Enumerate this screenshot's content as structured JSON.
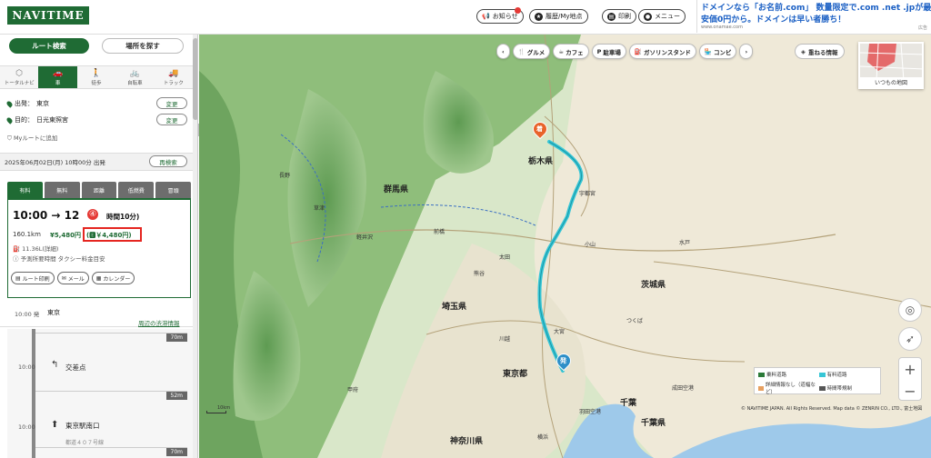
{
  "header": {
    "logo": "NAVITIME",
    "buttons": {
      "notice": "お知らせ",
      "history": "履歴/My地点",
      "print": "印刷",
      "menu": "メニュー"
    },
    "ad": {
      "line1": "ドメインなら「お名前.com」 数量限定で.com .net .jpが最",
      "line2": "安価0円から。ドメインは早い者勝ち！",
      "url": "www.onamae.com",
      "tag": "広告"
    }
  },
  "sidebar": {
    "modes": {
      "route": "ルート検索",
      "place": "場所を探す"
    },
    "transport": [
      {
        "label": "トータルナビ",
        "icon": "⬡"
      },
      {
        "label": "車",
        "icon": "🚗"
      },
      {
        "label": "徒歩",
        "icon": "🚶"
      },
      {
        "label": "自転車",
        "icon": "🚲"
      },
      {
        "label": "トラック",
        "icon": "🚚"
      }
    ],
    "origin_label": "出発：",
    "origin": "東京",
    "dest_label": "目的：",
    "dest": "日光東照宮",
    "change": "変更",
    "myroute": "Myルートに追加",
    "date": "2025年06月02日(月) 10時00分 出発",
    "research": "再検索",
    "fare_tabs": [
      "有料",
      "無料",
      "距離",
      "低燃費",
      "冒頭"
    ],
    "route": {
      "time": "10:00 → 12",
      "duration": "時間10分)",
      "badge": "④",
      "distance": "160.1km",
      "fare": "¥5,480円",
      "etc_fare": "(🅴￥4,480円)",
      "fuel": "11.36L(詳細)",
      "note": "予測所要時間 タクシー料金目安",
      "buttons": [
        "ルート印刷",
        "メール",
        "カレンダー"
      ]
    },
    "start": {
      "time": "10:00 発",
      "name": "東京",
      "nearby": "周辺の渋滞情報"
    },
    "steps": [
      {
        "dist": "70m"
      },
      {
        "time": "10:00",
        "icon": "↰",
        "name": "交差点"
      },
      {
        "dist": "52m"
      },
      {
        "time": "10:00",
        "icon": "⬆",
        "name": "東京駅南口",
        "sub": "都道４０７号線"
      },
      {
        "dist": "70m"
      }
    ]
  },
  "map": {
    "categories": [
      "グルメ",
      "カフェ",
      "駐車場",
      "ガソリンスタンド",
      "コンビ"
    ],
    "layers": "重ねる情報",
    "minimap_label": "いつもの地図",
    "legend": [
      "乗料道路",
      "有料道路",
      "詳細情報なし（道幅など）",
      "時間帯規制"
    ],
    "copyright": "© NAVITIME JAPAN. All Rights Reserved. Map data © ZENRIN CO., LTD., 富士地図",
    "scale": "10km",
    "labels": {
      "tochigi": "栃木県",
      "gunma": "群馬県",
      "saitama": "埼玉県",
      "ibaraki": "茨城県",
      "tokyo": "東京都",
      "kanagawa": "神奈川県",
      "chiba": "千葉県",
      "chiba2": "千葉",
      "nagano": "長野",
      "utsunomiya": "宇都宮",
      "oyama": "小山",
      "mito": "水戸",
      "maebashi": "前橋",
      "kumagaya": "熊谷",
      "omiya": "大宮",
      "kofu": "甲府",
      "yokohama": "横浜",
      "kusatsu": "草津",
      "karuizawa": "軽井沢",
      "tsukuba": "つくば",
      "kawagoe": "川越",
      "narita": "成田空港",
      "haneda": "羽田空港",
      "ota": "太田"
    },
    "start_pin": "発",
    "end_pin": "着"
  }
}
